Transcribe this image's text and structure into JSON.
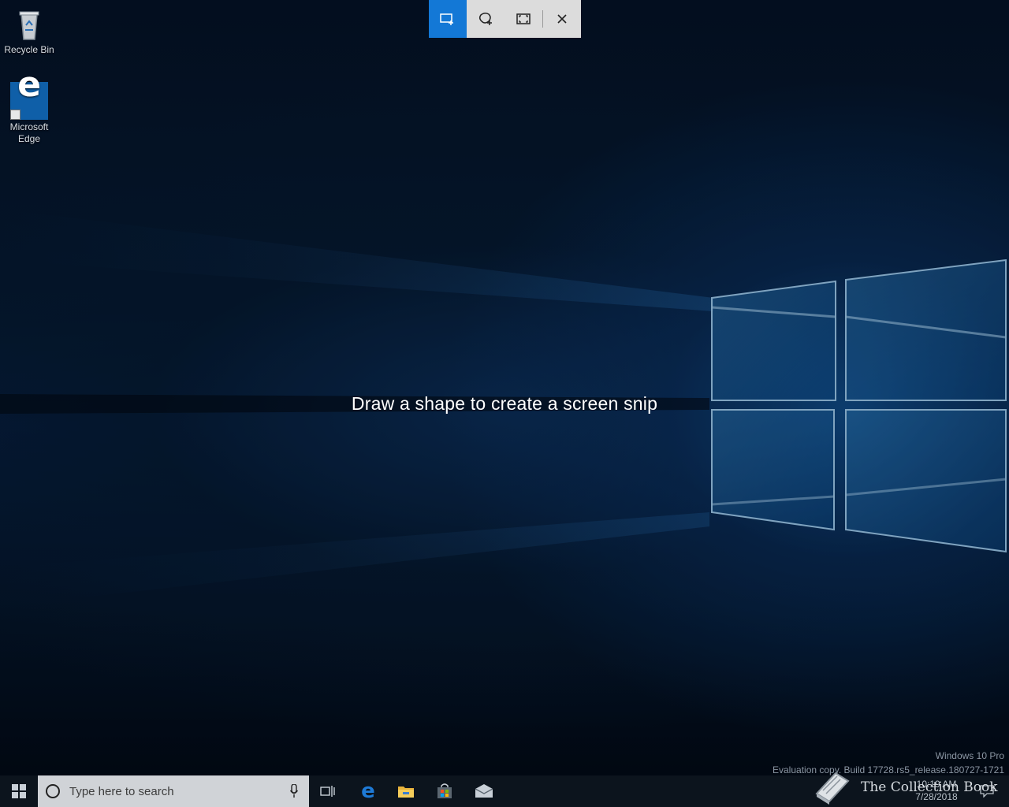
{
  "desktop": {
    "icons": [
      {
        "label": "Recycle Bin",
        "icon": "recycle-bin-icon"
      },
      {
        "label_line1": "Microsoft",
        "label_line2": "Edge",
        "icon": "edge-icon"
      }
    ]
  },
  "snip_toolbar": {
    "modes": [
      {
        "name": "rectangular-snip",
        "icon": "rectangle-snip-icon",
        "active": true
      },
      {
        "name": "freeform-snip",
        "icon": "freeform-snip-icon",
        "active": false
      },
      {
        "name": "fullscreen-snip",
        "icon": "fullscreen-snip-icon",
        "active": false
      }
    ],
    "close_icon": "close-icon",
    "active_color": "#1378d6",
    "bar_color": "#dcdcdc"
  },
  "instruction": "Draw a shape to create a screen snip",
  "watermark": {
    "line1": "Windows 10 Pro",
    "line2": "Evaluation copy. Build 17728.rs5_release.180727-1721"
  },
  "taskbar": {
    "search_placeholder": "Type here to search",
    "pinned": [
      "task-view-icon",
      "edge-icon",
      "file-explorer-icon",
      "store-icon",
      "mail-icon"
    ],
    "clock_time": "10:19 AM",
    "clock_date": "7/28/2018"
  },
  "brand_overlay": {
    "text": "The Collection Book",
    "icon": "book-icon"
  }
}
